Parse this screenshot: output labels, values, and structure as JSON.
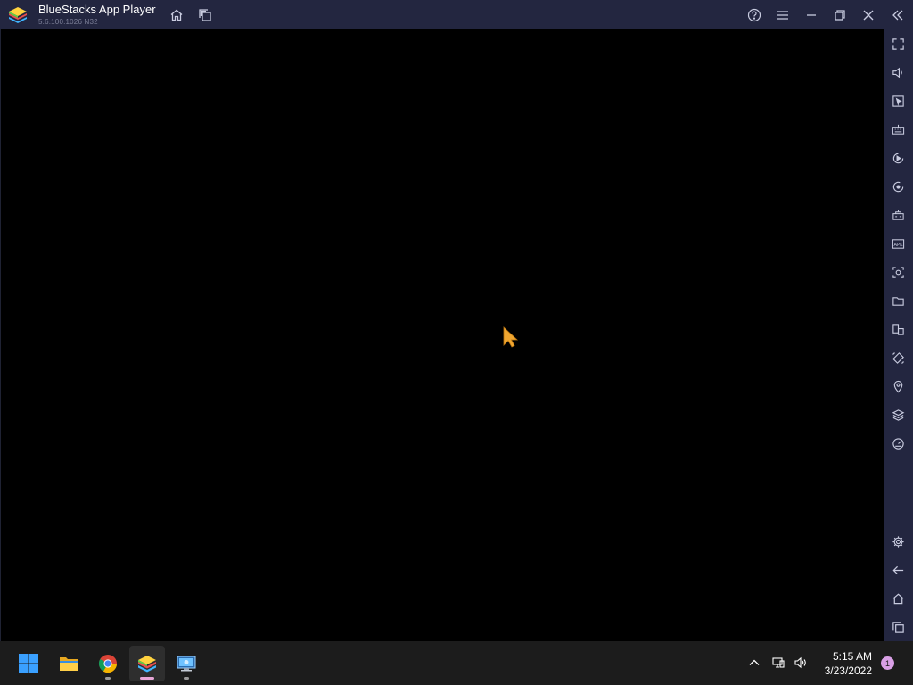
{
  "window": {
    "title": "BlueStacks App Player",
    "version": "5.6.100.1026  N32"
  },
  "titlebar": {
    "left_buttons": [
      {
        "icon": "home-icon",
        "tooltip": ""
      },
      {
        "icon": "multi-instance-icon",
        "tooltip": ""
      }
    ],
    "right_buttons": [
      {
        "icon": "help-icon"
      },
      {
        "icon": "menu-icon"
      },
      {
        "icon": "minimize-icon"
      },
      {
        "icon": "restore-icon"
      },
      {
        "icon": "close-icon"
      },
      {
        "icon": "collapse-sidebar-icon"
      }
    ]
  },
  "sidebar": {
    "items": [
      {
        "icon": "fullscreen-icon"
      },
      {
        "icon": "volume-icon"
      },
      {
        "icon": "pointer-mode-icon"
      },
      {
        "icon": "keyboard-controls-icon"
      },
      {
        "icon": "macro-icon"
      },
      {
        "icon": "sync-icon"
      },
      {
        "icon": "game-controls-icon"
      },
      {
        "icon": "install-apk-icon"
      },
      {
        "icon": "screenshot-icon"
      },
      {
        "icon": "folder-icon"
      },
      {
        "icon": "multi-instance-icon"
      },
      {
        "icon": "rotate-icon"
      },
      {
        "icon": "location-icon"
      },
      {
        "icon": "layers-icon"
      },
      {
        "icon": "speedometer-icon"
      }
    ],
    "bottom_items": [
      {
        "icon": "settings-icon"
      },
      {
        "icon": "back-icon"
      },
      {
        "icon": "home-icon"
      },
      {
        "icon": "recent-apps-icon"
      }
    ]
  },
  "taskbar": {
    "apps": [
      {
        "icon": "windows-start-icon",
        "active": false,
        "running": false
      },
      {
        "icon": "file-explorer-icon",
        "active": false,
        "running": false
      },
      {
        "icon": "chrome-icon",
        "active": false,
        "running": true
      },
      {
        "icon": "bluestacks-icon",
        "active": true,
        "running": true
      },
      {
        "icon": "remote-desktop-icon",
        "active": false,
        "running": true
      }
    ],
    "tray": {
      "time": "5:15 AM",
      "date": "3/23/2022",
      "notifications": "1"
    }
  },
  "colors": {
    "titlebar_bg": "#232640",
    "screen_bg": "#000000",
    "cursor": "#f0a630",
    "taskbar_bg": "#1c1c1c",
    "accent_pink": "#d9a0e6"
  }
}
